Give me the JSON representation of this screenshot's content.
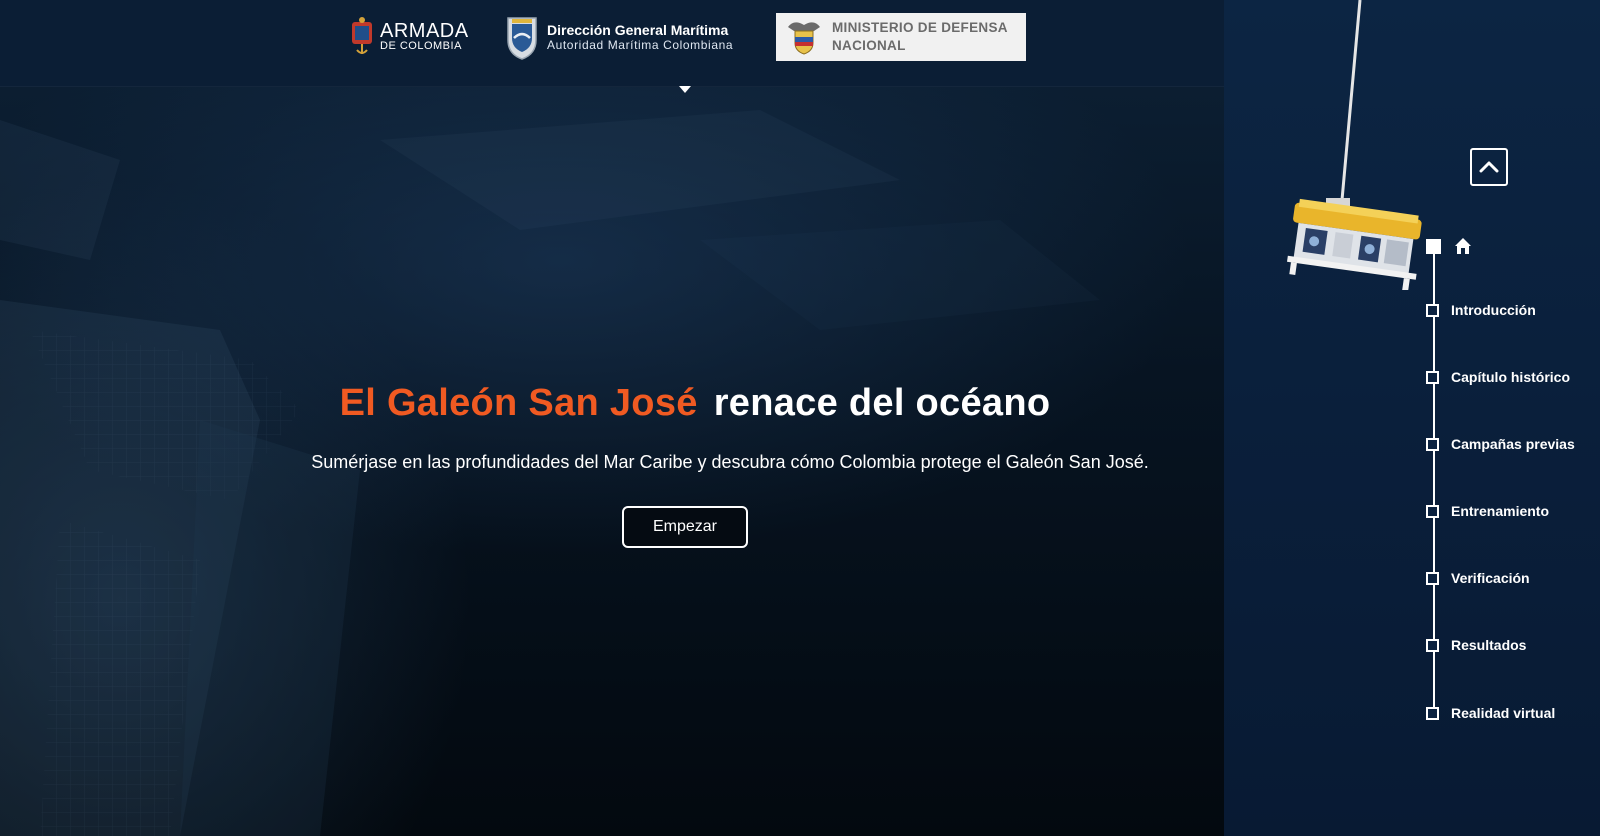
{
  "header": {
    "logos": [
      {
        "name": "armada",
        "line1": "ARMADA",
        "line2": "DE COLOMBIA"
      },
      {
        "name": "dimar",
        "line1": "Dirección General Marítima",
        "line2": "Autoridad Marítima Colombiana"
      },
      {
        "name": "mindef",
        "line1": "MINISTERIO DE DEFENSA",
        "line2": "NACIONAL"
      }
    ],
    "caret_icon": "caret-down-icon"
  },
  "hero": {
    "title_accent": "El Galeón San José",
    "title_rest": "renace del océano",
    "subtitle": "Sumérjase en las profundidades del Mar Caribe y descubra cómo Colombia protege el Galeón San José.",
    "cta_label": "Empezar"
  },
  "sidebar": {
    "scroll_top_icon": "chevron-up-icon",
    "home_icon": "home-icon",
    "items": [
      {
        "label": "Introducción"
      },
      {
        "label": "Capítulo histórico"
      },
      {
        "label": "Campañas previas"
      },
      {
        "label": "Entrenamiento"
      },
      {
        "label": "Verificación"
      },
      {
        "label": "Resultados"
      },
      {
        "label": "Realidad virtual"
      }
    ],
    "active_index": 0
  },
  "colors": {
    "accent": "#f05a22",
    "panel": "#0a2140",
    "header": "#0b1e35",
    "text": "#ffffff"
  }
}
